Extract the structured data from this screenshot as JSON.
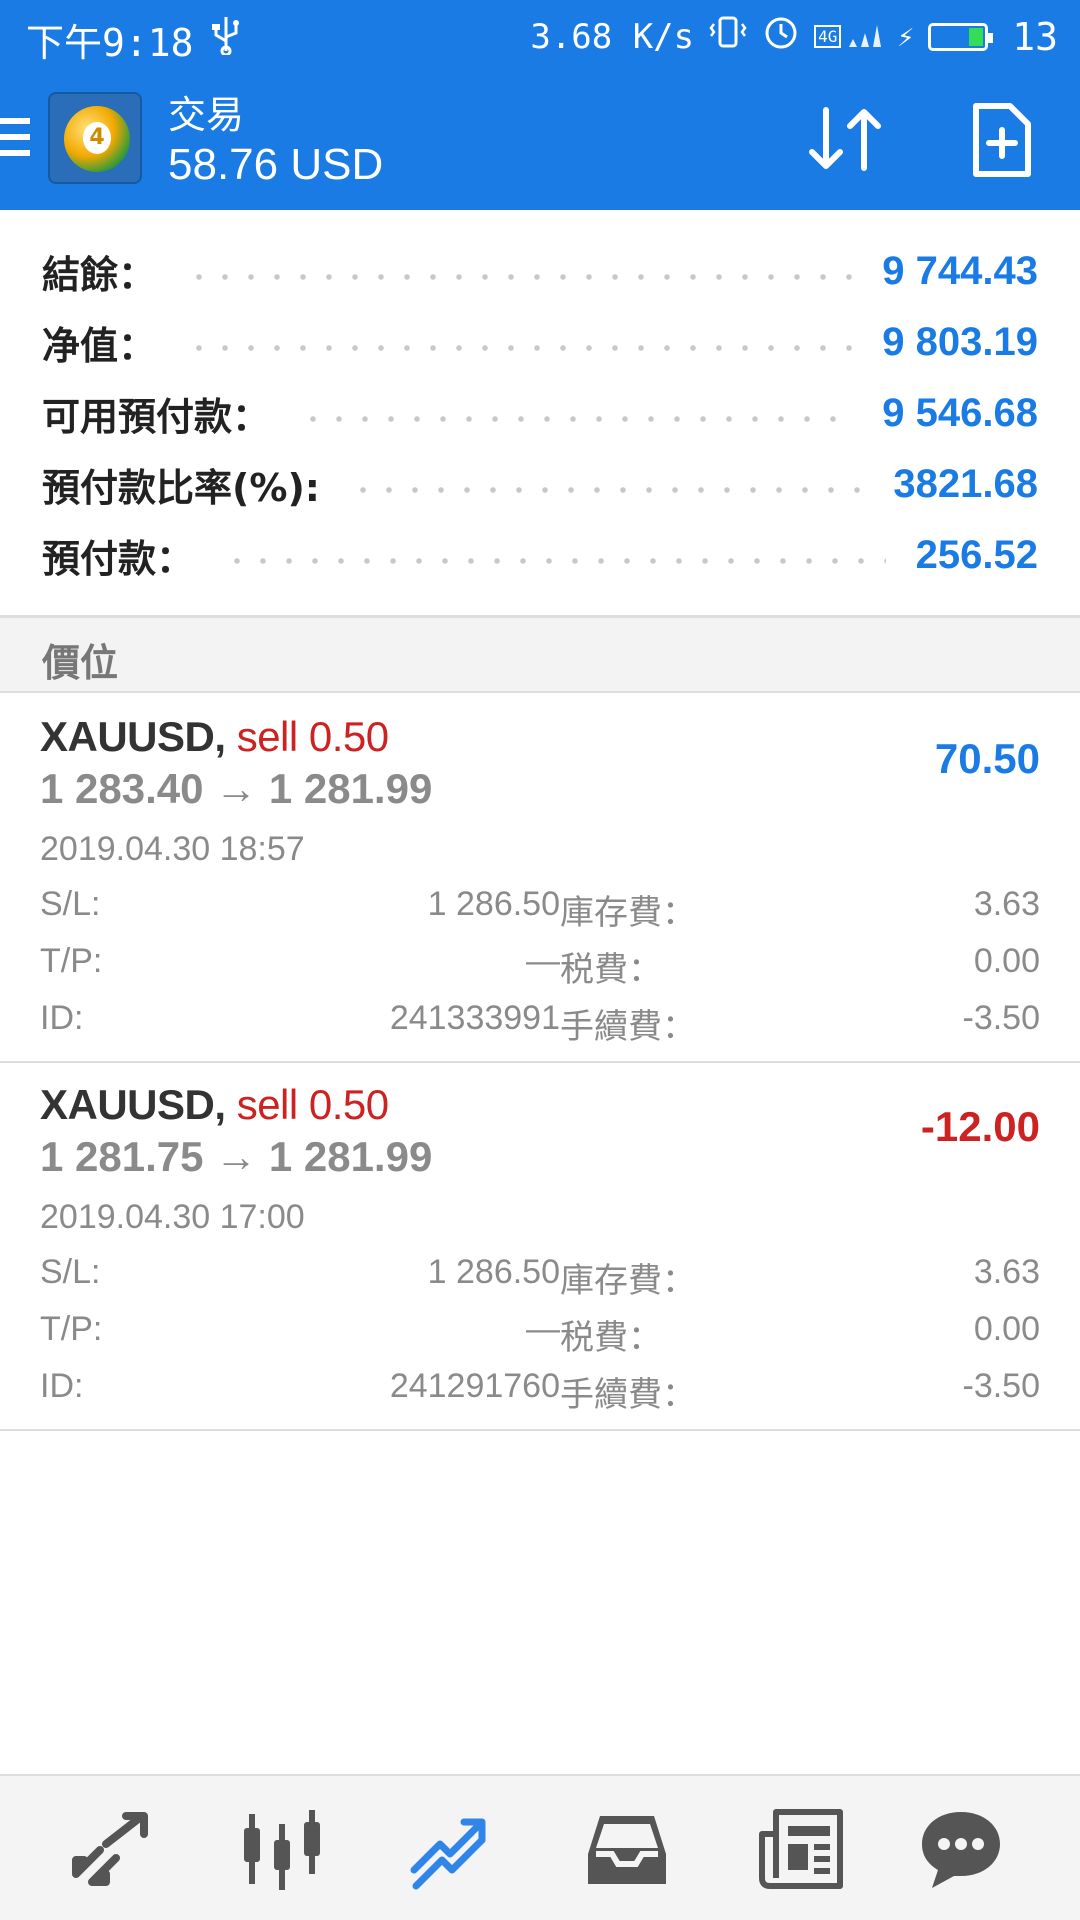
{
  "status_bar": {
    "time": "下午9:18",
    "network_speed": "3.68 K/s",
    "network_type": "4G",
    "battery_level": "13"
  },
  "header": {
    "title": "交易",
    "subtitle": "58.76 USD",
    "icons": [
      "menu-icon",
      "metatrader-logo",
      "sort-icon",
      "new-document-icon"
    ]
  },
  "summary": [
    {
      "label": "結餘：",
      "value": "9 744.43"
    },
    {
      "label": "净值：",
      "value": "9 803.19"
    },
    {
      "label": "可用預付款：",
      "value": "9 546.68"
    },
    {
      "label": "預付款比率(%):",
      "value": "3821.68"
    },
    {
      "label": "預付款：",
      "value": "256.52"
    }
  ],
  "section": {
    "title": "價位"
  },
  "positions": [
    {
      "symbol": "XAUUSD,",
      "type": "sell 0.50",
      "prices": "1 283.40 → 1 281.99",
      "profit": "70.50",
      "profit_color": "#1a7be5",
      "time": "2019.04.30 18:57",
      "sl_label": "S/L:",
      "sl_value": "1 286.50",
      "tp_label": "T/P:",
      "tp_value": "—",
      "id_label": "ID:",
      "id_value": "241333991",
      "swap_label": "庫存費：",
      "swap_value": "3.63",
      "tax_label": "税費：",
      "tax_value": "0.00",
      "commission_label": "手續費：",
      "commission_value": "-3.50"
    },
    {
      "symbol": "XAUUSD,",
      "type": "sell 0.50",
      "prices": "1 281.75 → 1 281.99",
      "profit": "-12.00",
      "profit_color": "#cc2222",
      "time": "2019.04.30 17:00",
      "sl_label": "S/L:",
      "sl_value": "1 286.50",
      "tp_label": "T/P:",
      "tp_value": "—",
      "id_label": "ID:",
      "id_value": "241291760",
      "swap_label": "庫存費：",
      "swap_value": "3.63",
      "tax_label": "税費：",
      "tax_value": "0.00",
      "commission_label": "手續費：",
      "commission_value": "-3.50"
    }
  ],
  "bottom_nav": {
    "items": [
      "quotes-icon",
      "chart-icon",
      "trade-icon",
      "history-icon",
      "news-icon",
      "chat-icon"
    ],
    "active": "trade-icon",
    "colors": {
      "active": "#2f86e8",
      "inactive": "#555555"
    }
  }
}
